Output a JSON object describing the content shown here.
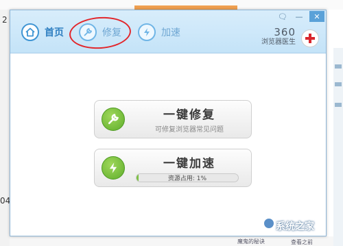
{
  "background": {
    "left_fragments": [
      "2",
      "04"
    ],
    "bottom_text": "魔鬼的秘诀",
    "right_small_text": "查看之前",
    "watermark": "系统之家"
  },
  "window": {
    "nav": [
      {
        "label": "首页",
        "icon": "home-icon",
        "active": true
      },
      {
        "label": "修复",
        "icon": "wrench-icon",
        "active": false
      },
      {
        "label": "加速",
        "icon": "lightning-icon",
        "active": false
      }
    ],
    "controls": {
      "menu": "🗨",
      "minimize": "—",
      "close": "✕"
    },
    "brand": {
      "number": "360",
      "name": "浏览器医生"
    },
    "accent_color": "#3f95d3",
    "annotation_color": "#e2262b"
  },
  "repair": {
    "title": "一键修复",
    "subtitle": "可修复浏览器常见问题",
    "icon": "wrench-icon"
  },
  "speedup": {
    "title": "一键加速",
    "progress_text": "资源占用: 1%",
    "progress_value": 0.01,
    "icon": "lightning-icon"
  }
}
